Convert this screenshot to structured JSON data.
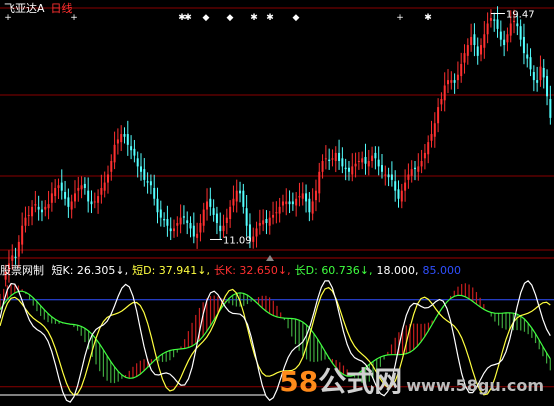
{
  "header": {
    "stock_name": "飞亚达A",
    "period": "日线"
  },
  "indicator": {
    "name": "股票网制",
    "items": [
      {
        "label": "短K",
        "value": "26.305",
        "arrow": "↓",
        "color": "#ffffff"
      },
      {
        "label": "短D",
        "value": "37.941",
        "arrow": "↓",
        "color": "#ffff40"
      },
      {
        "label": "长K",
        "value": "32.650",
        "arrow": "↓",
        "color": "#ff3030"
      },
      {
        "label": "长D",
        "value": "60.736",
        "arrow": "↓",
        "color": "#40ff40"
      },
      {
        "label": "",
        "value": "18.000",
        "arrow": "",
        "color": "#ffffff"
      },
      {
        "label": "",
        "value": "85.000",
        "arrow": "",
        "color": "#3050ff"
      }
    ]
  },
  "watermark": {
    "num": "58",
    "text": "公式网",
    "site": "www.58gu.com"
  },
  "colors": {
    "up": "#ff3030",
    "down": "#54ffff",
    "grid": "#8a0000",
    "signal": "#ffffff",
    "blue_line": "#3050ff"
  },
  "chart_data": [
    {
      "type": "candlestick",
      "title": "飞亚达A 日线",
      "price_labels": {
        "high": "19.47",
        "low": "11.09"
      },
      "close": [
        9.9,
        10.2,
        10.5,
        10.4,
        11.0,
        11.6,
        11.9,
        12.0,
        12.3,
        12.4,
        12.2,
        12.1,
        12.3,
        12.4,
        12.8,
        13.0,
        13.1,
        12.9,
        12.6,
        12.3,
        12.5,
        12.8,
        13.0,
        13.1,
        13.0,
        12.5,
        12.4,
        12.5,
        12.7,
        13.0,
        13.2,
        13.5,
        14.0,
        14.6,
        14.8,
        15.0,
        14.9,
        14.6,
        14.4,
        14.2,
        13.8,
        13.6,
        13.3,
        13.2,
        13.1,
        12.6,
        12.1,
        11.9,
        11.8,
        11.6,
        11.4,
        11.5,
        11.7,
        11.9,
        11.9,
        11.7,
        11.5,
        11.2,
        11.3,
        11.7,
        12.2,
        12.5,
        12.3,
        12.0,
        11.7,
        11.4,
        11.6,
        11.9,
        12.3,
        12.6,
        12.9,
        12.8,
        12.3,
        11.6,
        11.1,
        11.2,
        11.5,
        11.7,
        11.8,
        11.7,
        11.9,
        12.0,
        12.1,
        12.3,
        12.5,
        12.5,
        12.4,
        12.4,
        12.6,
        12.7,
        12.8,
        12.5,
        12.1,
        12.5,
        12.9,
        13.6,
        14.0,
        14.1,
        14.0,
        14.1,
        14.3,
        14.0,
        13.8,
        13.7,
        13.6,
        13.8,
        13.9,
        14.0,
        14.1,
        13.9,
        14.0,
        14.2,
        14.1,
        13.8,
        13.6,
        13.5,
        13.4,
        13.3,
        12.9,
        12.6,
        12.9,
        13.2,
        13.5,
        13.7,
        13.7,
        13.8,
        14.0,
        14.3,
        14.7,
        15.0,
        15.4,
        16.0,
        16.3,
        16.8,
        17.0,
        17.0,
        16.9,
        17.2,
        17.6,
        18.0,
        18.3,
        18.6,
        18.3,
        17.9,
        18.3,
        18.7,
        19.1,
        19.3,
        19.2,
        18.9,
        18.5,
        18.3,
        18.7,
        19.1,
        19.2,
        19.0,
        18.5,
        18.0,
        17.8,
        17.4,
        17.0,
        16.9,
        17.5,
        17.1,
        16.4,
        15.6
      ],
      "markers_top": [
        "+",
        "+",
        "✱",
        "✱",
        "◆",
        "◆",
        "✱",
        "✱",
        "◆",
        "+",
        "✱"
      ]
    },
    {
      "type": "indicator",
      "name": "股票网制",
      "series": [
        {
          "name": "短K",
          "value": 26.305,
          "trend": "down"
        },
        {
          "name": "短D",
          "value": 37.941,
          "trend": "down"
        },
        {
          "name": "长K",
          "value": 32.65,
          "trend": "down"
        },
        {
          "name": "长D",
          "value": 60.736,
          "trend": "down"
        }
      ],
      "levels": [
        18.0,
        85.0
      ]
    }
  ]
}
